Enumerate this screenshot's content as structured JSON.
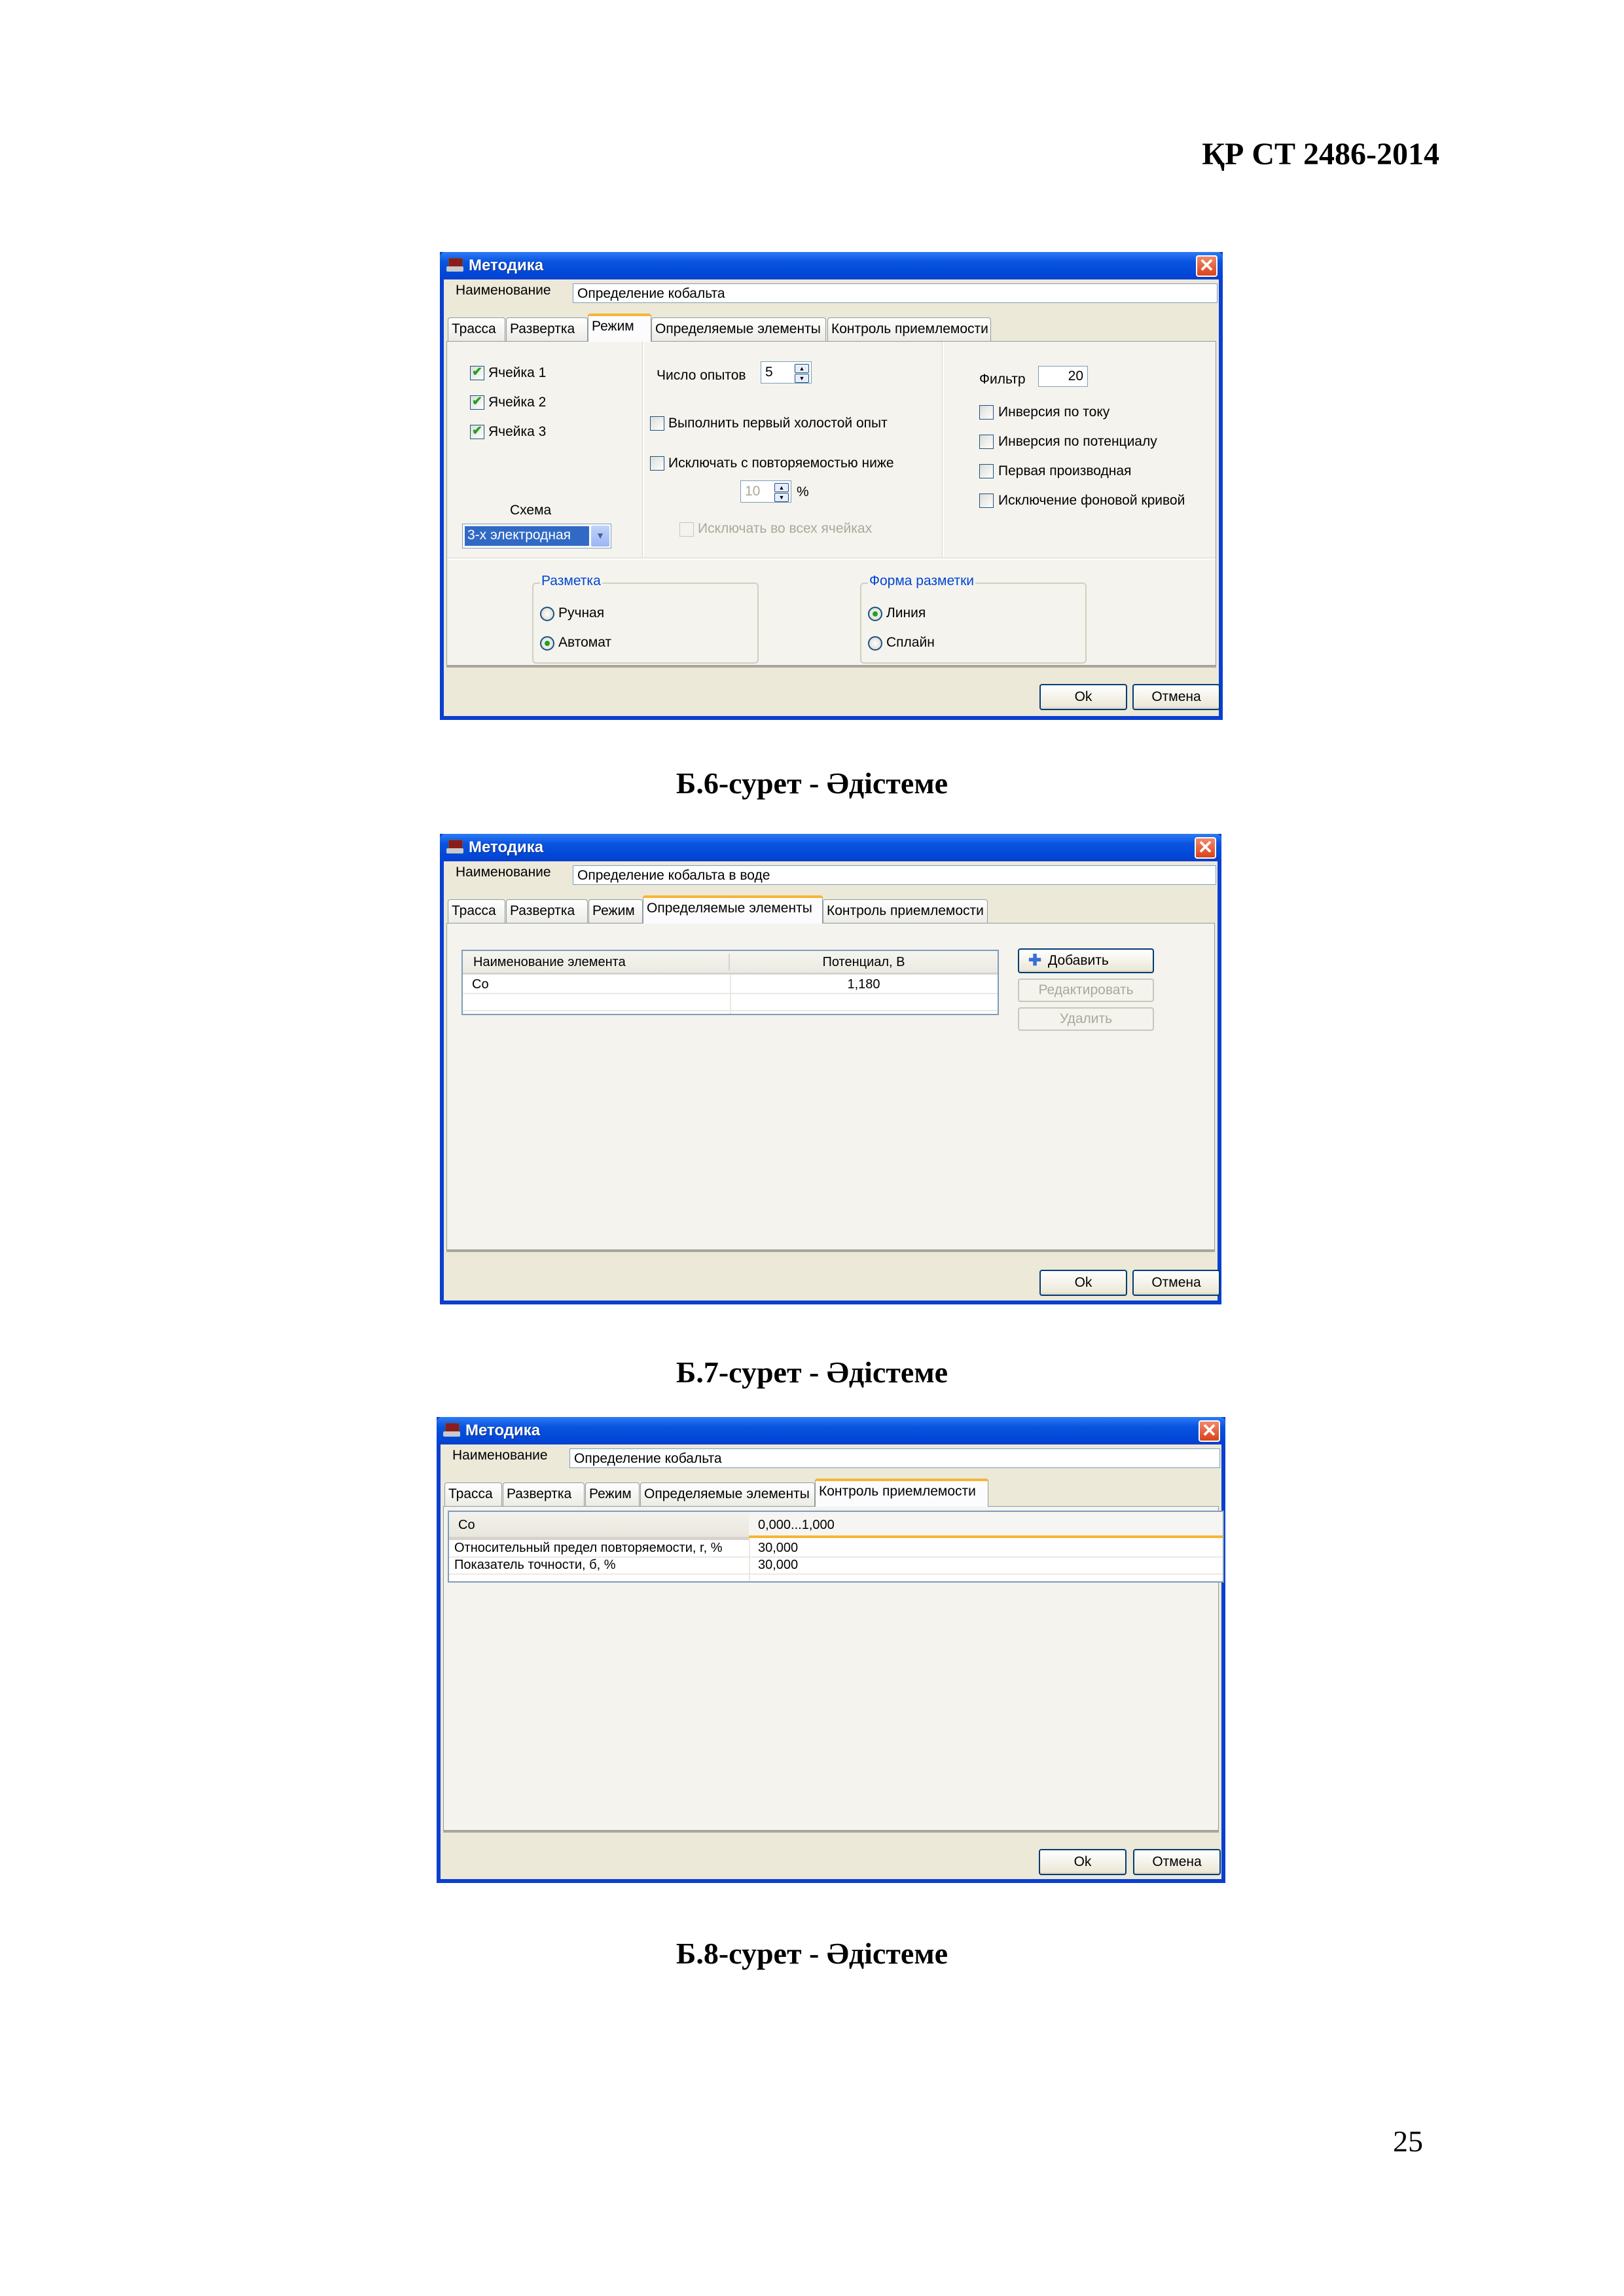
{
  "page": {
    "header": "ҚР СТ 2486-2014",
    "page_number": "25"
  },
  "dialogs": [
    {
      "title": "Методика",
      "name_label": "Наименование",
      "name_value": "Определение кобальта",
      "tabs": [
        "Трасса",
        "Развертка",
        "Режим",
        "Определяемые элементы",
        "Контроль приемлемости"
      ],
      "active_tab": "Режим",
      "cells": [
        {
          "label": "Ячейка 1",
          "checked": true
        },
        {
          "label": "Ячейка 2",
          "checked": true
        },
        {
          "label": "Ячейка 3",
          "checked": true
        }
      ],
      "scheme_label": "Схема",
      "scheme_value": "3-х электродная",
      "runs_label": "Число опытов",
      "runs_value": "5",
      "blank_run_label": "Выполнить первый холостой опыт",
      "blank_run_checked": false,
      "exclude_label": "Исключать с повторяемостью ниже",
      "exclude_checked": false,
      "exclude_percent_value": "10",
      "percent_sign": "%",
      "exclude_all_label": "Исключать во всех ячейках",
      "filter_label": "Фильтр",
      "filter_value": "20",
      "options": [
        {
          "label": "Инверсия по току",
          "checked": false
        },
        {
          "label": "Инверсия по потенциалу",
          "checked": false
        },
        {
          "label": "Первая производная",
          "checked": false
        },
        {
          "label": "Исключение фоновой кривой",
          "checked": false
        }
      ],
      "marking_group": {
        "title": "Разметка",
        "options": [
          {
            "label": "Ручная",
            "selected": false
          },
          {
            "label": "Автомат",
            "selected": true
          }
        ]
      },
      "marking_shape_group": {
        "title": "Форма разметки",
        "options": [
          {
            "label": "Линия",
            "selected": true
          },
          {
            "label": "Сплайн",
            "selected": false
          }
        ]
      },
      "ok_label": "Ok",
      "cancel_label": "Отмена",
      "caption": "Б.6-сурет - Әдістеме"
    },
    {
      "title": "Методика",
      "name_label": "Наименование",
      "name_value": "Определение кобальта в воде",
      "tabs": [
        "Трасса",
        "Развертка",
        "Режим",
        "Определяемые элементы",
        "Контроль приемлемости"
      ],
      "active_tab": "Определяемые элементы",
      "table": {
        "columns": [
          "Наименование элемента",
          "Потенциал, В"
        ],
        "rows": [
          [
            "Co",
            "1,180"
          ]
        ]
      },
      "add_label": "Добавить",
      "edit_label": "Редактировать",
      "delete_label": "Удалить",
      "ok_label": "Ok",
      "cancel_label": "Отмена",
      "caption": "Б.7-сурет - Әдістеме"
    },
    {
      "title": "Методика",
      "name_label": "Наименование",
      "name_value": "Определение кобальта",
      "tabs": [
        "Трасса",
        "Развертка",
        "Режим",
        "Определяемые элементы",
        "Контроль приемлемости"
      ],
      "active_tab": "Контроль приемлемости",
      "table": {
        "header": [
          "Co",
          "0,000...1,000"
        ],
        "rows": [
          [
            "Относительный предел повторяемости, r, %",
            "30,000"
          ],
          [
            "Показатель точности, б, %",
            "30,000"
          ]
        ]
      },
      "ok_label": "Ok",
      "cancel_label": "Отмена",
      "caption": "Б.8-сурет - Әдістеме"
    }
  ]
}
